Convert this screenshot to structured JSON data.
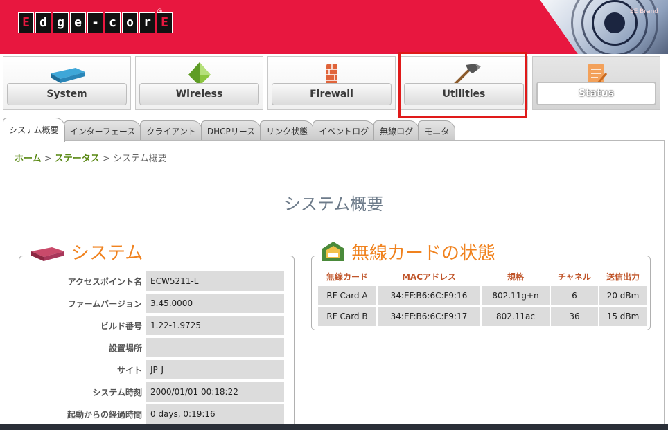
{
  "header": {
    "logo_letters": [
      "E",
      "d",
      "g",
      "e",
      "-",
      "c",
      "o",
      "r",
      "E"
    ],
    "reg_mark": "®",
    "corner_text": "SE Brand"
  },
  "nav": {
    "items": [
      {
        "label": "System",
        "icon": "router-icon"
      },
      {
        "label": "Wireless",
        "icon": "pyramid-icon"
      },
      {
        "label": "Firewall",
        "icon": "brick-wall-icon"
      },
      {
        "label": "Utilities",
        "icon": "hammer-icon"
      },
      {
        "label": "Status",
        "icon": "clipboard-icon"
      }
    ],
    "active": "Status",
    "highlight_color": "#e01a1a"
  },
  "tabs": [
    "システム概要",
    "インターフェース",
    "クライアント",
    "DHCPリース",
    "リンク状態",
    "イベントログ",
    "無線ログ",
    "モニタ"
  ],
  "breadcrumb": {
    "home": "ホーム",
    "sep1": " > ",
    "status": "ステータス",
    "sep2": " > ",
    "current": "システム概要"
  },
  "page_title": "システム概要",
  "system_panel": {
    "title": "システム",
    "rows": [
      {
        "label": "アクセスポイント名",
        "value": "ECW5211-L"
      },
      {
        "label": "ファームバージョン",
        "value": "3.45.0000"
      },
      {
        "label": "ビルド番号",
        "value": "1.22-1.9725"
      },
      {
        "label": "設置場所",
        "value": ""
      },
      {
        "label": "サイト",
        "value": "JP-J"
      },
      {
        "label": "システム時刻",
        "value": "2000/01/01 00:18:22"
      },
      {
        "label": "起動からの経過時間",
        "value": "0 days, 0:19:16"
      }
    ]
  },
  "wireless_panel": {
    "title": "無線カードの状態",
    "headers": [
      "無線カード",
      "MACアドレス",
      "規格",
      "チャネル",
      "送信出力"
    ],
    "rows": [
      [
        "RF Card A",
        "34:EF:B6:6C:F9:16",
        "802.11g+n",
        "6",
        "20 dBm"
      ],
      [
        "RF Card B",
        "34:EF:B6:6C:F9:17",
        "802.11ac",
        "36",
        "15 dBm"
      ]
    ]
  },
  "colors": {
    "brand_red": "#e8173f",
    "accent_orange": "#f0821e",
    "link_green": "#5b8a16"
  }
}
